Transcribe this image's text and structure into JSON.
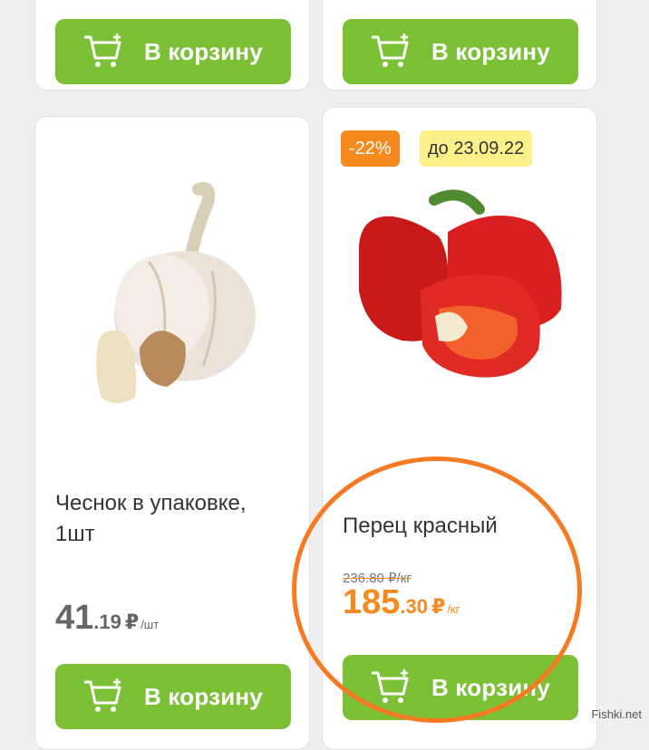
{
  "cart_button_label": "В корзину",
  "products": [
    {
      "name": "Чеснок в упаковке, 1шт",
      "price_rub": "41",
      "price_kop": ".19",
      "currency": "₽",
      "unit": "/шт"
    },
    {
      "name": "Перец красный",
      "discount": "-22%",
      "valid_until": "до 23.09.22",
      "old_price": "236.80 ₽/кг",
      "price_rub": "185",
      "price_kop": ".30",
      "currency": "₽",
      "unit": "/кг"
    }
  ],
  "watermark": "Fishki.net",
  "colors": {
    "button_green": "#7cc036",
    "discount_orange": "#f58a1f",
    "date_badge_yellow": "#fbf08a",
    "highlight_orange": "#f57a22"
  }
}
